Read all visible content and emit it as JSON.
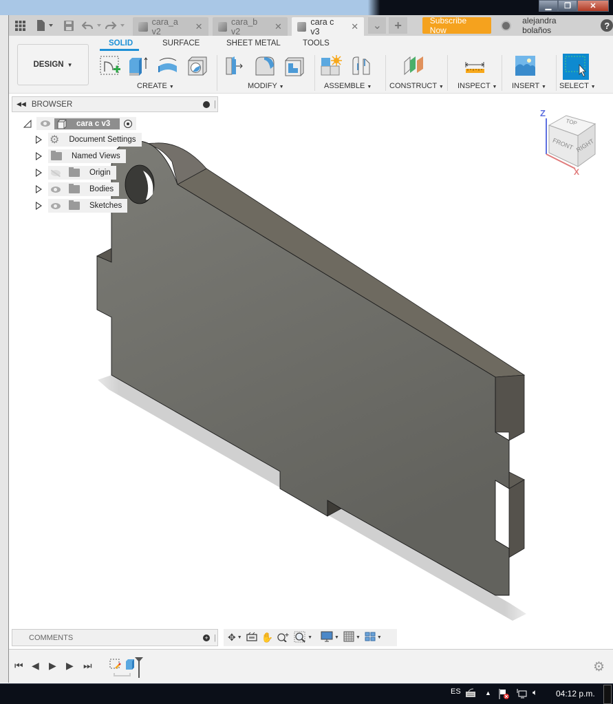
{
  "window": {
    "controls": [
      "minimize",
      "restore",
      "close"
    ]
  },
  "tabbar": {
    "icons": [
      "apps-grid-icon",
      "file-icon",
      "save-icon",
      "undo-icon",
      "redo-icon"
    ],
    "tabs": [
      {
        "label": "cara_a v2",
        "active": false
      },
      {
        "label": "cara_b v2",
        "active": false
      },
      {
        "label": "cara c v3",
        "active": true
      }
    ],
    "subscribe_label": "Subscribe Now",
    "user_name": "alejandra bolaños"
  },
  "ribbon": {
    "workspace_label": "DESIGN",
    "tabs": [
      "SOLID",
      "SURFACE",
      "SHEET METAL",
      "TOOLS"
    ],
    "active_tab": "SOLID",
    "groups": [
      "CREATE",
      "MODIFY",
      "ASSEMBLE",
      "CONSTRUCT",
      "INSPECT",
      "INSERT",
      "SELECT"
    ],
    "accent": "#1e90d6"
  },
  "browser": {
    "title": "BROWSER",
    "root": "cara c v3",
    "items": [
      {
        "label": "Document Settings",
        "icon": "gear-icon",
        "visible": null
      },
      {
        "label": "Named Views",
        "icon": "folder-icon",
        "visible": null
      },
      {
        "label": "Origin",
        "icon": "folder-icon",
        "visible": false
      },
      {
        "label": "Bodies",
        "icon": "folder-icon",
        "visible": true
      },
      {
        "label": "Sketches",
        "icon": "folder-icon",
        "visible": true
      }
    ]
  },
  "viewcube": {
    "faces": [
      "TOP",
      "FRONT",
      "RIGHT"
    ],
    "axes": [
      "Z",
      "X"
    ]
  },
  "comments": {
    "title": "COMMENTS"
  },
  "taskbar": {
    "language": "ES",
    "time": "04:12 p.m."
  }
}
